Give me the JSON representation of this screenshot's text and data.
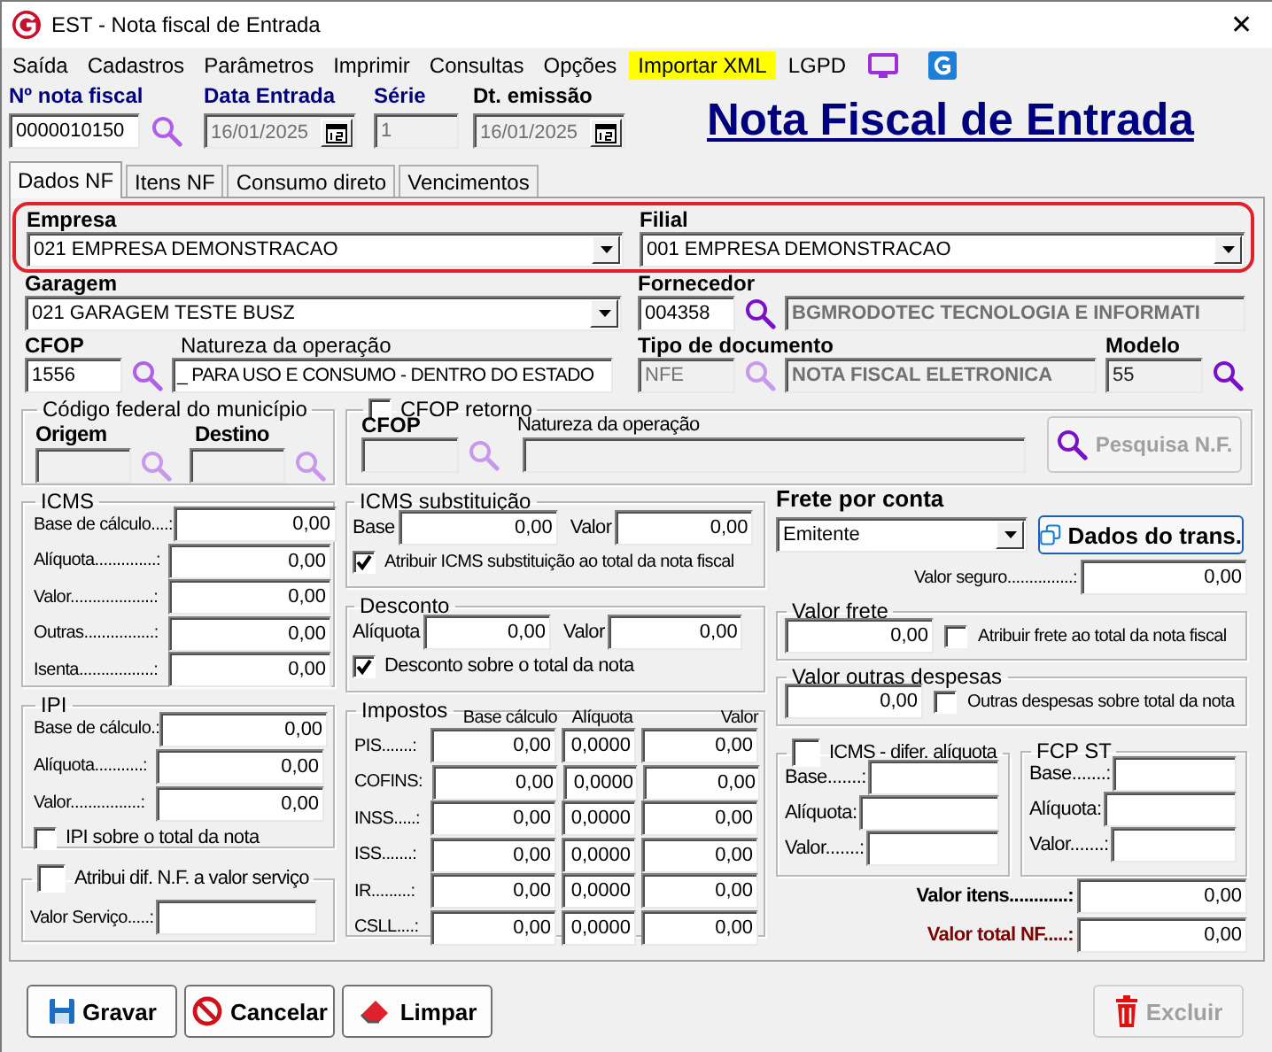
{
  "window": {
    "title": "EST - Nota fiscal de Entrada",
    "close": "✕"
  },
  "menu": [
    {
      "label": "Saída",
      "highlighted": false
    },
    {
      "label": "Cadastros",
      "highlighted": false
    },
    {
      "label": "Parâmetros",
      "highlighted": false
    },
    {
      "label": "Imprimir",
      "highlighted": false
    },
    {
      "label": "Consultas",
      "highlighted": false
    },
    {
      "label": "Opções",
      "highlighted": false
    },
    {
      "label": "Importar XML",
      "highlighted": true
    },
    {
      "label": "LGPD",
      "highlighted": false
    }
  ],
  "header": {
    "nota_fiscal": {
      "label": "Nº nota fiscal",
      "value": "0000010150"
    },
    "data_entrada": {
      "label": "Data Entrada",
      "value": "16/01/2025"
    },
    "serie": {
      "label": "Série",
      "value": "1"
    },
    "dt_emissao": {
      "label": "Dt. emissão",
      "value": "16/01/2025"
    }
  },
  "page_title": "Nota Fiscal de Entrada",
  "tabs": [
    {
      "label": "Dados NF",
      "selected": true
    },
    {
      "label": "Itens NF",
      "selected": false
    },
    {
      "label": "Consumo direto",
      "selected": false
    },
    {
      "label": "Vencimentos",
      "selected": false
    }
  ],
  "company_row": {
    "highlighted": true,
    "empresa": {
      "label": "Empresa",
      "value": "021 EMPRESA DEMONSTRACAO"
    },
    "filial": {
      "label": "Filial",
      "value": "001 EMPRESA DEMONSTRACAO"
    }
  },
  "garagem": {
    "label": "Garagem",
    "value": "021 GARAGEM TESTE BUSZ"
  },
  "fornecedor": {
    "label": "Fornecedor",
    "code": "004358",
    "name": "BGMRODOTEC TECNOLOGIA E INFORMATI"
  },
  "cfop": {
    "label": "CFOP",
    "code": "1556",
    "natureza_label": "Natureza da operação",
    "natureza": "_ PARA USO E CONSUMO - DENTRO DO ESTADO"
  },
  "tipo_documento": {
    "label": "Tipo de documento",
    "code": "NFE",
    "name": "NOTA FISCAL ELETRONICA"
  },
  "modelo": {
    "label": "Modelo",
    "value": "55"
  },
  "codigo_federal": {
    "title": "Código federal do município",
    "origem": "Origem",
    "destino": "Destino"
  },
  "cfop_retorno": {
    "title": "CFOP retorno",
    "checked": false,
    "cfop_label": "CFOP",
    "natureza_label": "Natureza da operação",
    "button": {
      "label": "Pesquisa N.F.",
      "disabled": true
    }
  },
  "icms": {
    "title": "ICMS",
    "rows": [
      {
        "label": "Base de cálculo....:",
        "value": "0,00"
      },
      {
        "label": "Alíquota..............:",
        "value": "0,00"
      },
      {
        "label": "Valor...................:",
        "value": "0,00"
      },
      {
        "label": "Outras................:",
        "value": "0,00"
      },
      {
        "label": "Isenta.................:",
        "value": "0,00"
      }
    ]
  },
  "icms_substituicao": {
    "title": "ICMS substituição",
    "first_label": "Base",
    "first_value": "0,00",
    "valor_label": "Valor",
    "valor": "0,00",
    "option": {
      "label": "Atribuir ICMS substituição ao total da nota fiscal",
      "checked": true
    }
  },
  "desconto": {
    "title": "Desconto",
    "first_label": "Alíquota",
    "first_value": "0,00",
    "valor_label": "Valor",
    "valor": "0,00",
    "option": {
      "label": "Desconto sobre o total da nota",
      "checked": true
    }
  },
  "ipi": {
    "title": "IPI",
    "rows": [
      {
        "label": "Base de cálculo.:",
        "value": "0,00"
      },
      {
        "label": "Alíquota...........:",
        "value": "0,00"
      },
      {
        "label": "Valor................:",
        "value": "0,00"
      }
    ],
    "option": {
      "label": "IPI sobre o total da nota",
      "checked": false
    }
  },
  "atribui_dif": {
    "title": "Atribui dif. N.F. a valor serviço",
    "checked": false,
    "valor_label": "Valor Serviço.....:"
  },
  "impostos": {
    "title": "Impostos",
    "columns": [
      "Base cálculo",
      "Alíquota",
      "Valor"
    ],
    "rows": [
      {
        "label": "PIS.......:",
        "values": [
          "0,00",
          "0,0000",
          "0,00"
        ]
      },
      {
        "label": "COFINS:",
        "values": [
          "0,00",
          "0,0000",
          "0,00"
        ]
      },
      {
        "label": "INSS.....:",
        "values": [
          "0,00",
          "0,0000",
          "0,00"
        ]
      },
      {
        "label": "ISS.......:",
        "values": [
          "0,00",
          "0,0000",
          "0,00"
        ]
      },
      {
        "label": "IR.........:",
        "values": [
          "0,00",
          "0,0000",
          "0,00"
        ]
      },
      {
        "label": "CSLL....:",
        "values": [
          "0,00",
          "0,0000",
          "0,00"
        ]
      }
    ]
  },
  "frete": {
    "label": "Frete por conta",
    "value": "Emitente",
    "button": "Dados do trans.",
    "seguro_label": "Valor seguro...............:",
    "seguro": "0,00"
  },
  "valor_frete": {
    "title": "Valor frete",
    "value": "0,00",
    "option": {
      "label": "Atribuir frete ao total da nota fiscal",
      "checked": false
    }
  },
  "outras_despesas": {
    "title": "Valor outras despesas",
    "value": "0,00",
    "option": {
      "label": "Outras despesas sobre total da nota",
      "checked": false
    }
  },
  "icms_difer": {
    "title": "ICMS - difer. alíquota",
    "checked": false,
    "rows": [
      "Base.......:",
      "Alíquota:",
      "Valor.......:"
    ]
  },
  "fcp_st": {
    "title": "FCP ST",
    "rows": [
      "Base.......:",
      "Alíquota:",
      "Valor.......:"
    ]
  },
  "totals": [
    {
      "kind": "items",
      "label": "Valor itens............:",
      "value": "0,00"
    },
    {
      "kind": "total",
      "label": "Valor total NF.....:",
      "value": "0,00"
    }
  ],
  "buttons": [
    {
      "kind": "save",
      "label": "Gravar",
      "disabled": false
    },
    {
      "kind": "cancel",
      "label": "Cancelar",
      "disabled": false
    },
    {
      "kind": "clear",
      "label": "Limpar",
      "disabled": false
    },
    {
      "kind": "delete",
      "label": "Excluir",
      "disabled": true
    }
  ]
}
